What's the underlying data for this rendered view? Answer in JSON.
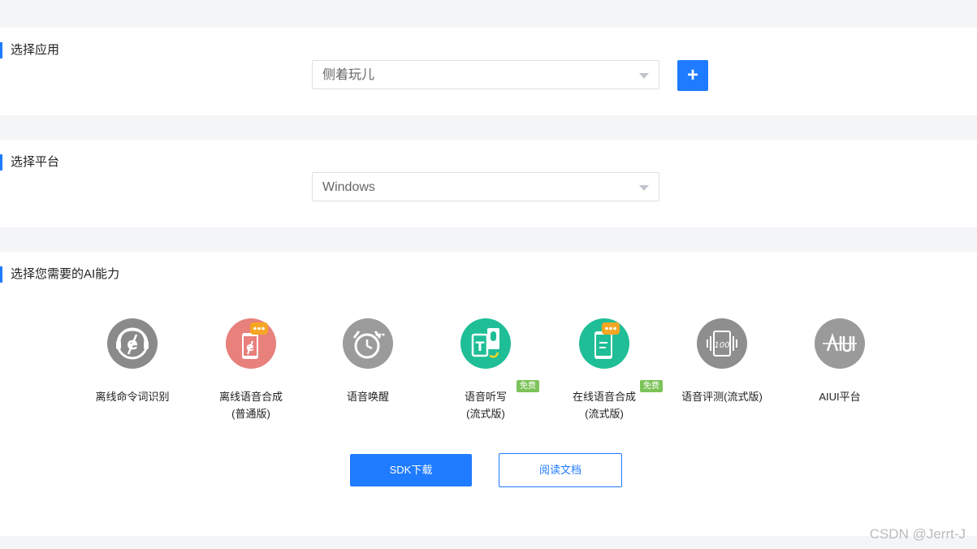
{
  "app_section": {
    "title": "选择应用",
    "selected_app": "侧着玩儿",
    "add_label": "+"
  },
  "platform_section": {
    "title": "选择平台",
    "selected_platform": "Windows"
  },
  "ai_section": {
    "title": "选择您需要的AI能力",
    "items": [
      {
        "line1": "离线命令词识别",
        "line2": "",
        "icon": "offline-command-icon",
        "color": "#8a8a8a"
      },
      {
        "line1": "离线语音合成",
        "line2": "(普通版)",
        "icon": "offline-tts-icon",
        "color": "#e8807c"
      },
      {
        "line1": "语音唤醒",
        "line2": "",
        "icon": "wake-alarm-icon",
        "color": "#9b9b9b"
      },
      {
        "line1": "语音听写",
        "line2": "(流式版)",
        "icon": "dictation-icon",
        "color": "#1fbe97",
        "badge": "免费"
      },
      {
        "line1": "在线语音合成",
        "line2": "(流式版)",
        "icon": "online-tts-icon",
        "color": "#1fbe97",
        "badge": "免费"
      },
      {
        "line1": "语音评测(流式版)",
        "line2": "",
        "icon": "evaluation-icon",
        "color": "#8e8e8e"
      },
      {
        "line1": "AIUI平台",
        "line2": "",
        "icon": "aiui-icon",
        "color": "#9a9a9a"
      }
    ],
    "sdk_button": "SDK下载",
    "docs_button": "阅读文档"
  },
  "watermark": "CSDN @Jerrt-J"
}
